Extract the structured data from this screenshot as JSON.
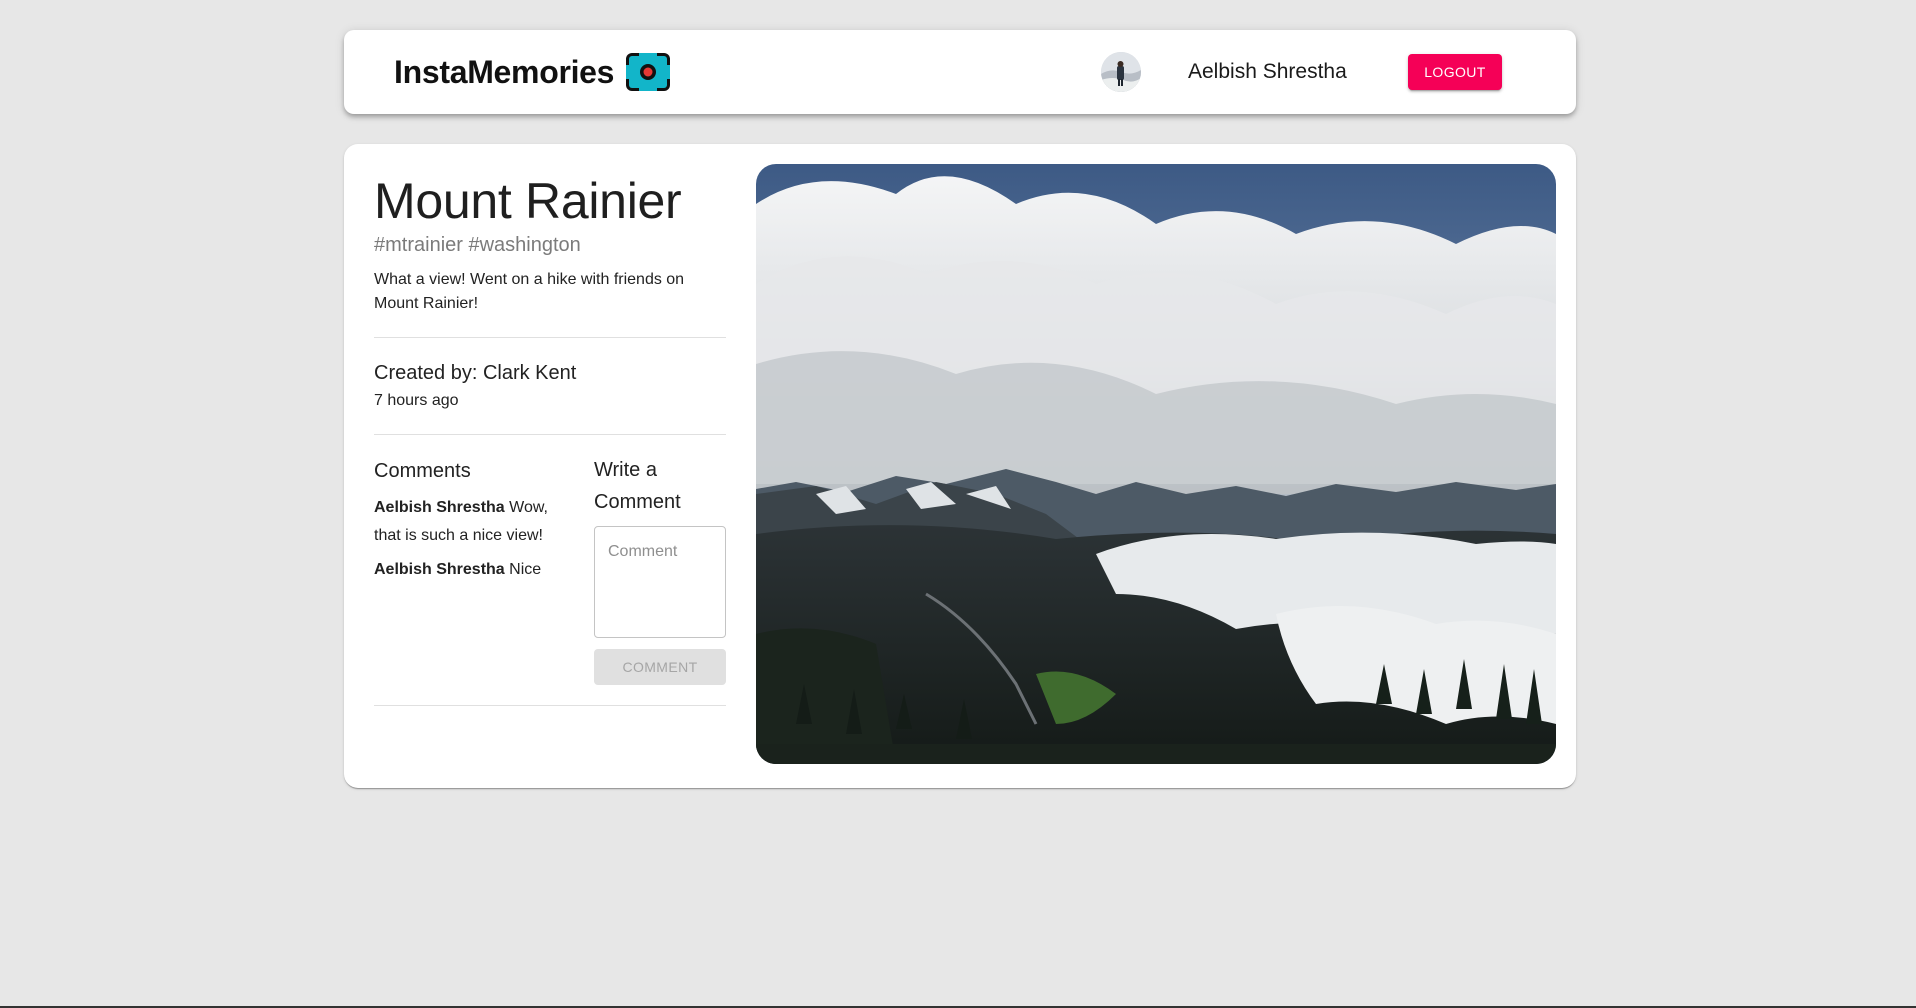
{
  "header": {
    "brand_title": "InstaMemories",
    "logo_icon": "camera-icon",
    "user_name": "Aelbish Shrestha",
    "logout_label": "LOGOUT",
    "accent_color": "#f50057"
  },
  "post": {
    "title": "Mount Rainier",
    "tags": "#mtrainier #washington",
    "message": "What a view! Went on a hike with friends on Mount Rainier!",
    "created_by": "Created by: Clark Kent",
    "time_ago": "7 hours ago",
    "image_icon": "mountain-landscape-photo"
  },
  "comments": {
    "heading": "Comments",
    "items": [
      {
        "author": "Aelbish Shrestha",
        "text": "Wow, that is such a nice view!"
      },
      {
        "author": "Aelbish Shrestha",
        "text": "Nice"
      }
    ]
  },
  "write_comment": {
    "heading": "Write a Comment",
    "placeholder": "Comment",
    "value": "",
    "button_label": "COMMENT"
  }
}
